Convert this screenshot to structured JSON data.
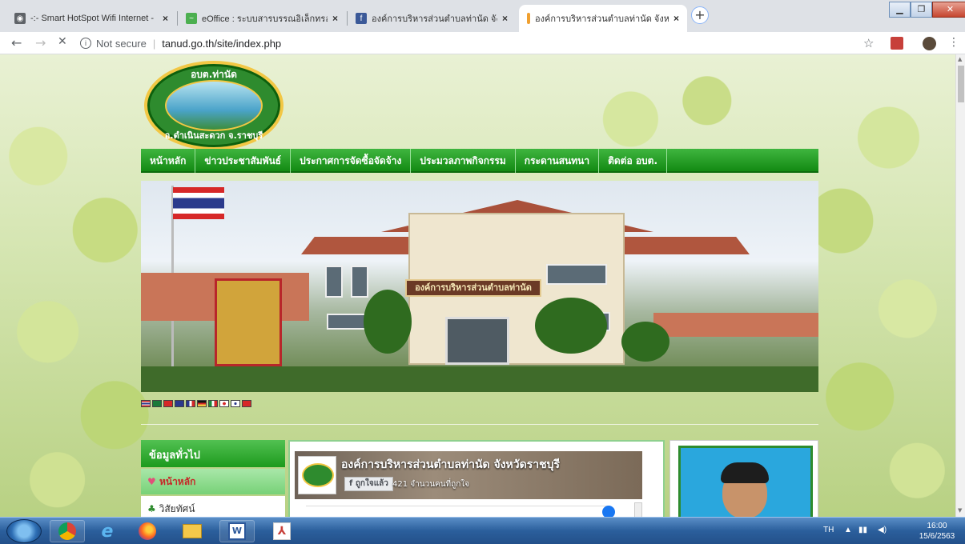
{
  "browser": {
    "tabs": [
      {
        "title": "-:- Smart HotSpot Wifi Internet -",
        "icon": "globe-icon"
      },
      {
        "title": "eOffice : ระบบสารบรรณอิเล็กทรอนิกส์",
        "icon": "eoffice-icon"
      },
      {
        "title": "องค์การบริหารส่วนตำบลท่านัด จังหวัดราชบุรี",
        "icon": "facebook-icon"
      },
      {
        "title": "องค์การบริหารส่วนตำบลท่านัด จังหวัดราชบุรี",
        "icon": "page-icon",
        "active": true
      }
    ],
    "close_glyph": "×",
    "new_tab_glyph": "+",
    "address": {
      "security": "Not secure",
      "url": "tanud.go.th/site/index.php"
    },
    "nav": {
      "back": "←",
      "forward": "→",
      "stop": "✕"
    }
  },
  "site": {
    "logo": {
      "top_text": "อบต.ท่านัด",
      "bottom_text": "อ.ดำเนินสะดวก จ.ราชบุรี"
    },
    "menu": [
      "หน้าหลัก",
      "ข่าวประชาสัมพันธ์",
      "ประกาศการจัดซื้อจัดจ้าง",
      "ประมวลภาพกิจกรรม",
      "กระดานสนทนา",
      "ติดต่อ อบต."
    ],
    "banner_sign": "องค์การบริหารส่วนตำบลท่านัด",
    "languages": [
      "TH",
      "LA",
      "CN",
      "GB",
      "FR",
      "DE",
      "IT",
      "JP",
      "KR",
      "VN"
    ],
    "sidebar": {
      "heading": "ข้อมูลทั่วไป",
      "items": [
        {
          "label": "หน้าหลัก",
          "glyph": "♥"
        },
        {
          "label": "วิสัยทัศน์",
          "glyph": "♣"
        }
      ]
    },
    "facebook": {
      "page_name": "องค์การบริหารส่วนตำบลท่านัด จังหวัดราชบุรี",
      "like_label": "ถูกใจแล้ว",
      "like_count": "421 จำนวนคนที่ถูกใจ"
    }
  },
  "taskbar": {
    "language": "TH",
    "time": "16:00",
    "date": "15/6/2563"
  },
  "colors": {
    "nav_green": "#138a13",
    "sidebar_highlight": "#c62828",
    "taskbar_blue": "#2b5f9c"
  }
}
